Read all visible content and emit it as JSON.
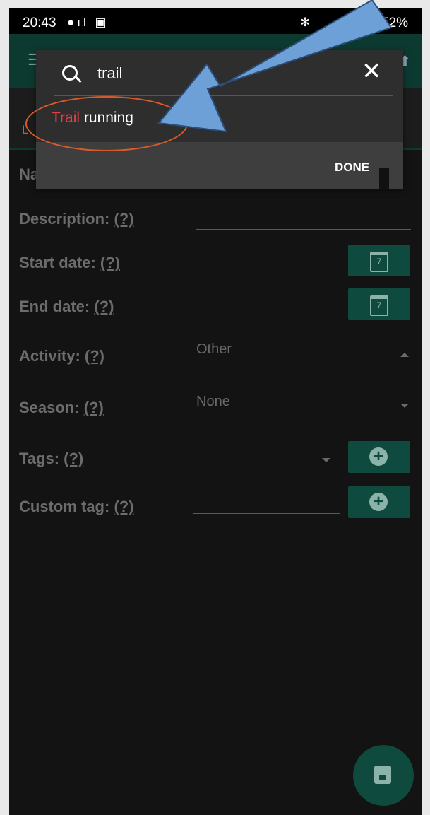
{
  "status": {
    "time": "20:43",
    "battery": "52%"
  },
  "tabs": {
    "first_initial": "L"
  },
  "form": {
    "name_label_partial": "Na",
    "description_label": "Description:",
    "start_label": "Start date:",
    "end_label": "End date:",
    "activity_label": "Activity:",
    "activity_value": "Other",
    "season_label": "Season:",
    "season_value": "None",
    "tags_label": "Tags:",
    "custom_tag_label": "Custom tag:",
    "help": "(?)",
    "calendar_day": "7"
  },
  "dialog": {
    "query": "trail",
    "result_highlight": "Trail",
    "result_rest": " running",
    "done_label": "DONE"
  },
  "colors": {
    "accent": "#0e4a3d",
    "highlight": "#e0404a",
    "annotation": "#6ea0d8",
    "circle": "#d95a2a"
  },
  "icons": [
    "menu-icon",
    "search-icon",
    "close-icon",
    "calendar-icon",
    "add-icon",
    "save-icon",
    "dropdown-caret-icon"
  ]
}
